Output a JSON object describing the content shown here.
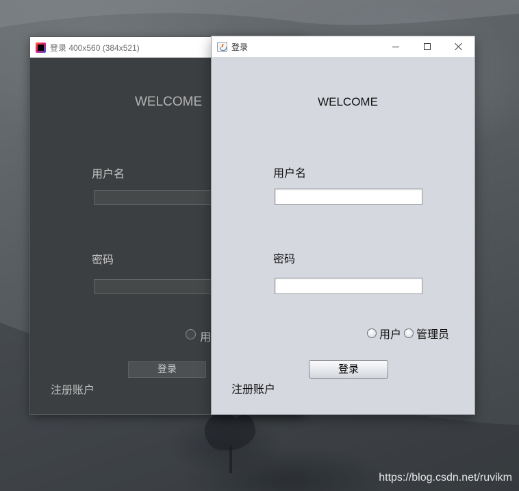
{
  "background_window": {
    "title": "登录 400x560 (384x521)",
    "welcome": "WELCOME",
    "username_label": "用户名",
    "password_label": "密码",
    "radio_partial_label": "用",
    "login_button": "登录",
    "register_link": "注册账户",
    "icon": "intellij-idea-icon",
    "colors": {
      "background": "#3c3f41",
      "text": "#c4c4c4"
    }
  },
  "login_window": {
    "title": "登录",
    "icon": "java-icon",
    "welcome": "WELCOME",
    "username_label": "用户名",
    "username_value": "",
    "password_label": "密码",
    "password_value": "",
    "roles": [
      {
        "label": "用户",
        "selected": false
      },
      {
        "label": "管理员",
        "selected": false
      }
    ],
    "login_button": "登录",
    "register_link": "注册账户",
    "controls": [
      "minimize-icon",
      "maximize-icon",
      "close-icon"
    ],
    "colors": {
      "background": "#d6d8e0",
      "titlebar": "#ffffff"
    }
  },
  "watermark": "https://blog.csdn.net/ruvikm"
}
